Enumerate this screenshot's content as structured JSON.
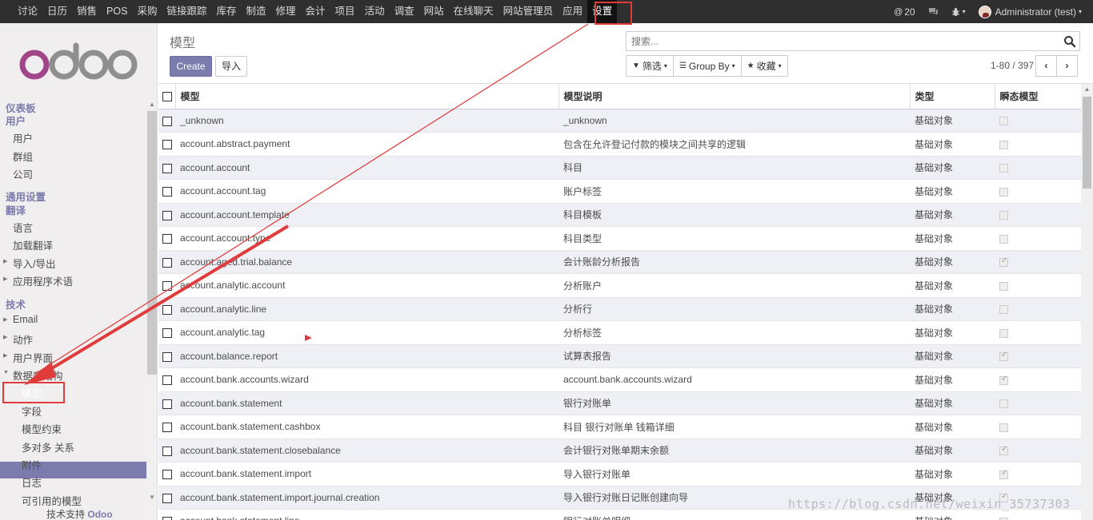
{
  "topnav": {
    "items": [
      "讨论",
      "日历",
      "销售",
      "POS",
      "采购",
      "链接跟踪",
      "库存",
      "制造",
      "修理",
      "会计",
      "项目",
      "活动",
      "调查",
      "网站",
      "在线聊天",
      "网站管理员",
      "应用",
      "设置"
    ],
    "active": "设置",
    "badge_count": "20",
    "user": "Administrator (test)"
  },
  "sidebar": {
    "sections": [
      {
        "title": "仪表板"
      },
      {
        "title": "用户",
        "items": [
          "用户",
          "群组",
          "公司"
        ]
      },
      {
        "title": "通用设置"
      },
      {
        "title": "翻译",
        "items": [
          "语言",
          "加载翻译",
          "导入/导出",
          "应用程序术语"
        ]
      },
      {
        "title": "技术",
        "items": [
          "Email",
          "动作",
          "用户界面",
          "数据库结构"
        ]
      }
    ],
    "db_items": [
      "模型",
      "字段",
      "模型约束",
      "多对多 关系",
      "附件",
      "日志",
      "可引用的模型"
    ],
    "footer_prefix": "技术支持",
    "footer_brand": "Odoo"
  },
  "control_panel": {
    "breadcrumb": "模型",
    "create_label": "Create",
    "import_label": "导入",
    "search_placeholder": "搜索...",
    "filter_label": "筛选",
    "groupby_label": "Group By",
    "favorites_label": "收藏",
    "pager": "1-80 / 397"
  },
  "table": {
    "headers": [
      "模型",
      "模型说明",
      "类型",
      "瞬态模型"
    ],
    "rows": [
      {
        "model": "_unknown",
        "desc": "_unknown",
        "type": "基础对象",
        "transient": false
      },
      {
        "model": "account.abstract.payment",
        "desc": "包含在允许登记付款的模块之间共享的逻辑",
        "type": "基础对象",
        "transient": false
      },
      {
        "model": "account.account",
        "desc": "科目",
        "type": "基础对象",
        "transient": false
      },
      {
        "model": "account.account.tag",
        "desc": "账户标签",
        "type": "基础对象",
        "transient": false
      },
      {
        "model": "account.account.template",
        "desc": "科目模板",
        "type": "基础对象",
        "transient": false
      },
      {
        "model": "account.account.type",
        "desc": "科目类型",
        "type": "基础对象",
        "transient": false
      },
      {
        "model": "account.aged.trial.balance",
        "desc": "会计账龄分析报告",
        "type": "基础对象",
        "transient": true
      },
      {
        "model": "account.analytic.account",
        "desc": "分析账户",
        "type": "基础对象",
        "transient": false
      },
      {
        "model": "account.analytic.line",
        "desc": "分析行",
        "type": "基础对象",
        "transient": false
      },
      {
        "model": "account.analytic.tag",
        "desc": "分析标签",
        "type": "基础对象",
        "transient": false
      },
      {
        "model": "account.balance.report",
        "desc": "试算表报告",
        "type": "基础对象",
        "transient": true
      },
      {
        "model": "account.bank.accounts.wizard",
        "desc": "account.bank.accounts.wizard",
        "type": "基础对象",
        "transient": true
      },
      {
        "model": "account.bank.statement",
        "desc": "银行对账单",
        "type": "基础对象",
        "transient": false
      },
      {
        "model": "account.bank.statement.cashbox",
        "desc": "科目   银行对账单   钱箱详细",
        "type": "基础对象",
        "transient": false
      },
      {
        "model": "account.bank.statement.closebalance",
        "desc": "会计银行对账单期末余额",
        "type": "基础对象",
        "transient": true
      },
      {
        "model": "account.bank.statement.import",
        "desc": "导入银行对账单",
        "type": "基础对象",
        "transient": true
      },
      {
        "model": "account.bank.statement.import.journal.creation",
        "desc": "导入银行对账日记账创建向导",
        "type": "基础对象",
        "transient": true
      },
      {
        "model": "account.bank.statement.line",
        "desc": "银行对账单明细",
        "type": "基础对象",
        "transient": false
      }
    ]
  },
  "watermark": "https://blog.csdn.net/weixin_35737303",
  "colors": {
    "accent": "#7c7bad",
    "topbar": "#2f2f2f",
    "annotation": "#e03c3c"
  }
}
